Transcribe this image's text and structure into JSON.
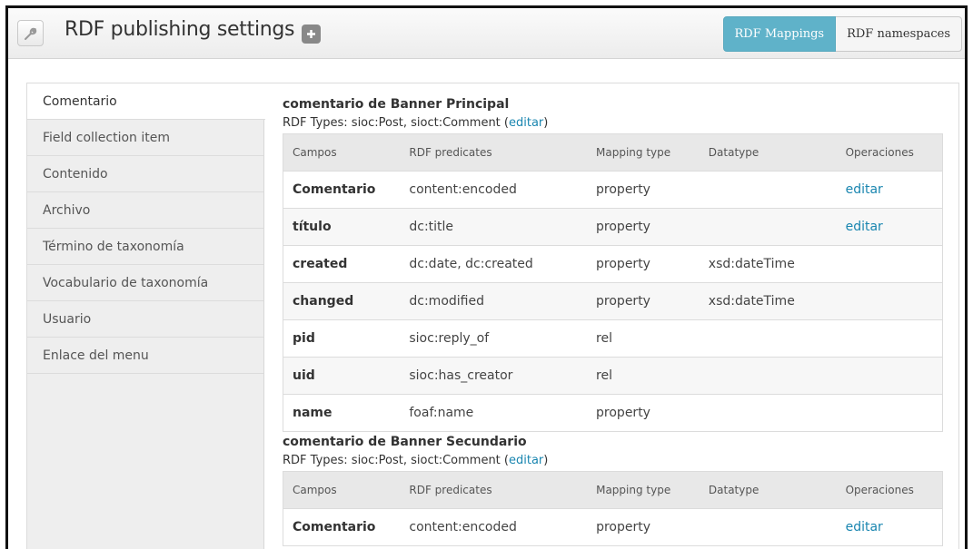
{
  "header": {
    "title": "RDF publishing settings",
    "tabs": [
      {
        "label": "RDF Mappings",
        "active": true
      },
      {
        "label": "RDF namespaces",
        "active": false
      }
    ]
  },
  "colors": {
    "accent": "#5fb2c9",
    "link": "#1a86b0"
  },
  "sidebar": {
    "items": [
      {
        "label": "Comentario",
        "active": true
      },
      {
        "label": "Field collection item"
      },
      {
        "label": "Contenido"
      },
      {
        "label": "Archivo"
      },
      {
        "label": "Término de taxonomía"
      },
      {
        "label": "Vocabulario de taxonomía"
      },
      {
        "label": "Usuario"
      },
      {
        "label": "Enlace del menu"
      }
    ]
  },
  "table_headers": [
    "Campos",
    "RDF predicates",
    "Mapping type",
    "Datatype",
    "Operaciones"
  ],
  "sections": [
    {
      "title": "comentario de Banner Principal",
      "rdf_types_prefix": "RDF Types: sioc:Post, sioct:Comment (",
      "edit_label": "editar",
      "rdf_types_suffix": ")",
      "rows": [
        {
          "field": "Comentario",
          "predicates": "content:encoded",
          "mapping": "property",
          "datatype": "",
          "op": "editar"
        },
        {
          "field": "título",
          "predicates": "dc:title",
          "mapping": "property",
          "datatype": "",
          "op": "editar"
        },
        {
          "field": "created",
          "predicates": "dc:date, dc:created",
          "mapping": "property",
          "datatype": "xsd:dateTime",
          "op": ""
        },
        {
          "field": "changed",
          "predicates": "dc:modified",
          "mapping": "property",
          "datatype": "xsd:dateTime",
          "op": ""
        },
        {
          "field": "pid",
          "predicates": "sioc:reply_of",
          "mapping": "rel",
          "datatype": "",
          "op": ""
        },
        {
          "field": "uid",
          "predicates": "sioc:has_creator",
          "mapping": "rel",
          "datatype": "",
          "op": ""
        },
        {
          "field": "name",
          "predicates": "foaf:name",
          "mapping": "property",
          "datatype": "",
          "op": ""
        }
      ]
    },
    {
      "title": "comentario de Banner Secundario",
      "rdf_types_prefix": "RDF Types: sioc:Post, sioct:Comment (",
      "edit_label": "editar",
      "rdf_types_suffix": ")",
      "rows": [
        {
          "field": "Comentario",
          "predicates": "content:encoded",
          "mapping": "property",
          "datatype": "",
          "op": "editar"
        }
      ]
    }
  ]
}
